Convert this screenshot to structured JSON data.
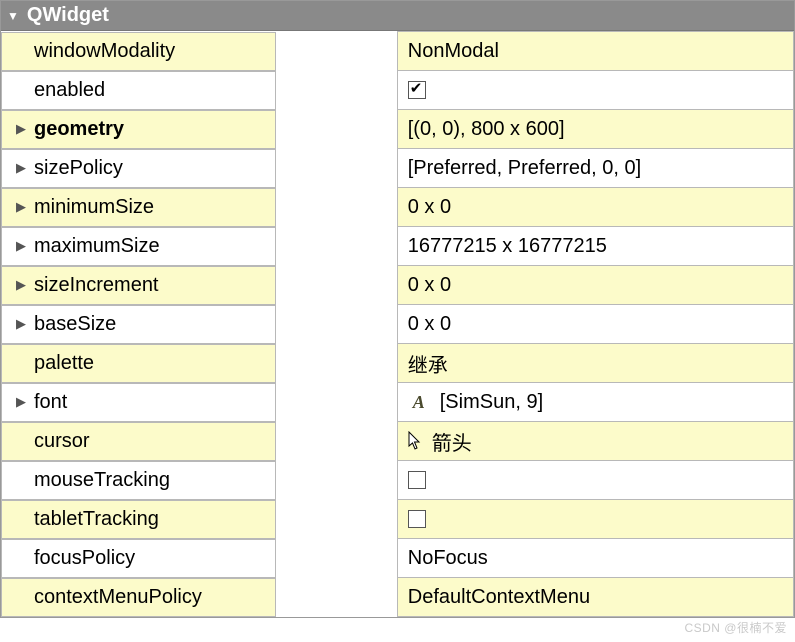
{
  "header": {
    "title": "QWidget"
  },
  "rows": [
    {
      "name": "windowModality",
      "value": "NonModal",
      "expandable": false,
      "bold": false,
      "type": "text",
      "alt": true
    },
    {
      "name": "enabled",
      "value": "",
      "expandable": false,
      "bold": false,
      "type": "checkbox",
      "checked": true,
      "alt": false
    },
    {
      "name": "geometry",
      "value": "[(0, 0), 800 x 600]",
      "expandable": true,
      "bold": true,
      "type": "text",
      "alt": true
    },
    {
      "name": "sizePolicy",
      "value": "[Preferred, Preferred, 0, 0]",
      "expandable": true,
      "bold": false,
      "type": "text",
      "alt": false
    },
    {
      "name": "minimumSize",
      "value": "0 x 0",
      "expandable": true,
      "bold": false,
      "type": "text",
      "alt": true
    },
    {
      "name": "maximumSize",
      "value": "16777215 x 16777215",
      "expandable": true,
      "bold": false,
      "type": "text",
      "alt": false
    },
    {
      "name": "sizeIncrement",
      "value": "0 x 0",
      "expandable": true,
      "bold": false,
      "type": "text",
      "alt": true
    },
    {
      "name": "baseSize",
      "value": "0 x 0",
      "expandable": true,
      "bold": false,
      "type": "text",
      "alt": false
    },
    {
      "name": "palette",
      "value": "继承",
      "expandable": false,
      "bold": false,
      "type": "text",
      "alt": true
    },
    {
      "name": "font",
      "value": "[SimSun, 9]",
      "expandable": true,
      "bold": false,
      "type": "font",
      "alt": false
    },
    {
      "name": "cursor",
      "value": "箭头",
      "expandable": false,
      "bold": false,
      "type": "cursor",
      "alt": true
    },
    {
      "name": "mouseTracking",
      "value": "",
      "expandable": false,
      "bold": false,
      "type": "checkbox",
      "checked": false,
      "alt": false
    },
    {
      "name": "tabletTracking",
      "value": "",
      "expandable": false,
      "bold": false,
      "type": "checkbox",
      "checked": false,
      "alt": true
    },
    {
      "name": "focusPolicy",
      "value": "NoFocus",
      "expandable": false,
      "bold": false,
      "type": "text",
      "alt": false
    },
    {
      "name": "contextMenuPolicy",
      "value": "DefaultContextMenu",
      "expandable": false,
      "bold": false,
      "type": "text",
      "alt": true
    }
  ],
  "watermark": "CSDN @很楠不爱"
}
